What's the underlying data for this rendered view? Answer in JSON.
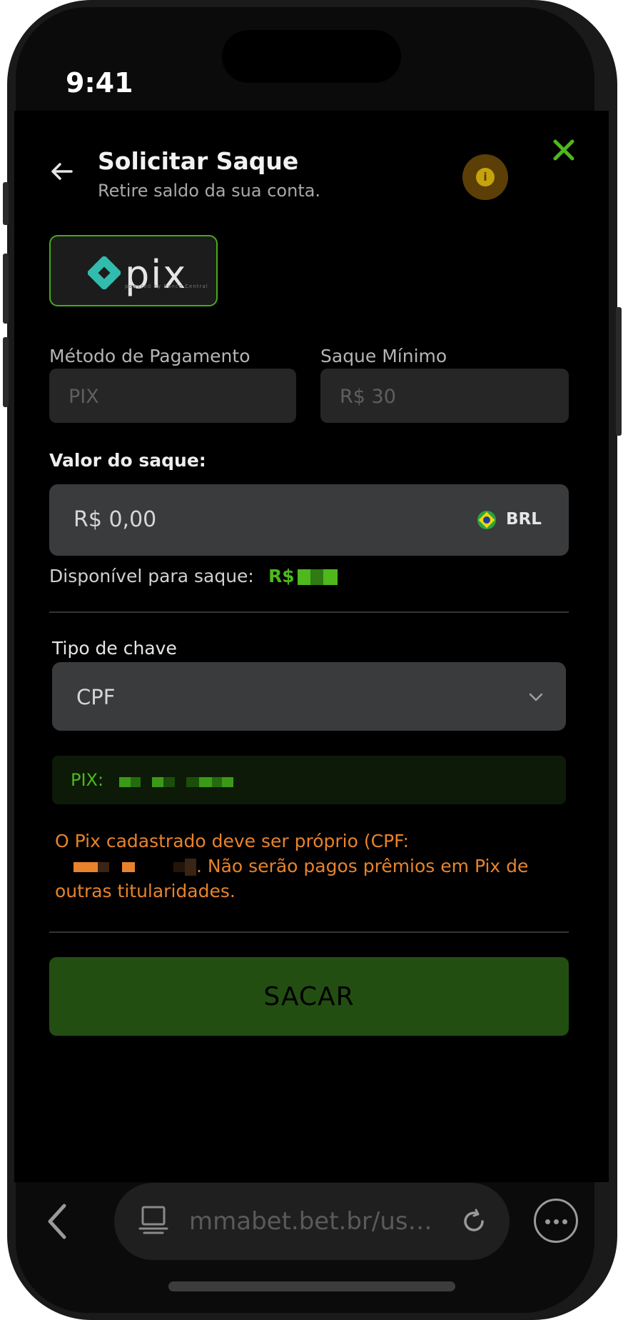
{
  "status_bar": {
    "time": "9:41"
  },
  "header": {
    "title": "Solicitar Saque",
    "subtitle": "Retire saldo da sua conta.",
    "info_icon": "info-icon",
    "close_icon": "close-icon",
    "back_icon": "arrow-left-icon"
  },
  "payment_method_card": {
    "logo_text": "pix",
    "logo_tagline": "powered by Banco Central"
  },
  "fields": {
    "method_label": "Método de Pagamento",
    "method_value": "PIX",
    "min_label": "Saque Mínimo",
    "min_value": "R$ 30"
  },
  "withdraw": {
    "label": "Valor do saque:",
    "amount": "R$ 0,00",
    "currency": "BRL",
    "available_label": "Disponível para saque:",
    "available_prefix": "R$"
  },
  "key": {
    "label": "Tipo de chave",
    "selected": "CPF",
    "pix_label": "PIX:"
  },
  "warning": {
    "text_start": "O Pix cadastrado deve ser próprio (CPF:",
    "text_end": ". Não serão pagos prêmios em Pix de outras titularidades."
  },
  "submit": {
    "label": "SACAR"
  },
  "browser": {
    "url": "mmabet.bet.br/us…"
  },
  "colors": {
    "accent_green": "#4fb81d",
    "warning_orange": "#e8832b",
    "button_green": "#234e12"
  }
}
